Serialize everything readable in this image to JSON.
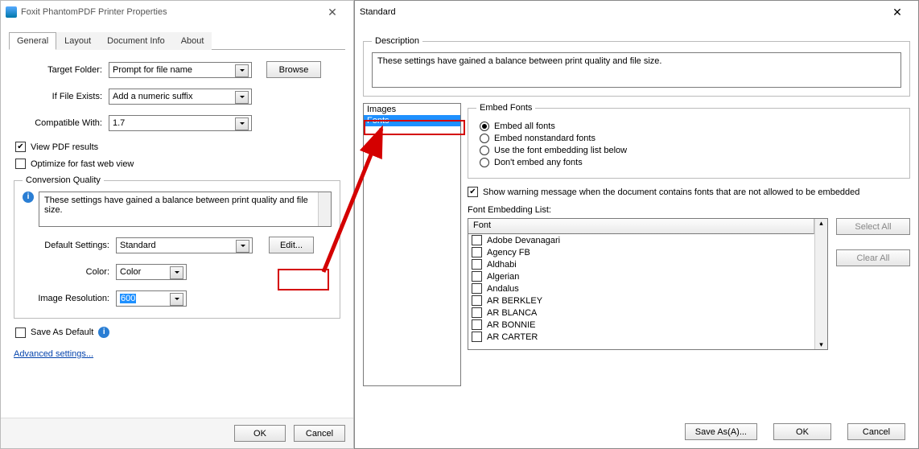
{
  "left": {
    "title": "Foxit PhantomPDF Printer Properties",
    "tabs": [
      "General",
      "Layout",
      "Document Info",
      "About"
    ],
    "activeTab": 0,
    "targetFolder": {
      "label": "Target Folder:",
      "value": "Prompt for file name",
      "browse": "Browse"
    },
    "ifExists": {
      "label": "If File Exists:",
      "value": "Add a numeric suffix"
    },
    "compatible": {
      "label": "Compatible With:",
      "value": "1.7"
    },
    "viewPdf": {
      "label": "View PDF results",
      "checked": true
    },
    "optimize": {
      "label": "Optimize for fast web view",
      "checked": false
    },
    "quality": {
      "legend": "Conversion Quality",
      "desc": "These settings have gained a balance between print quality and file size.",
      "defaultSettings": {
        "label": "Default Settings:",
        "value": "Standard",
        "edit": "Edit..."
      },
      "color": {
        "label": "Color:",
        "value": "Color"
      },
      "resolution": {
        "label": "Image Resolution:",
        "value": "600"
      }
    },
    "saveDefault": {
      "label": "Save As Default",
      "checked": false
    },
    "advanced": "Advanced settings...",
    "ok": "OK",
    "cancel": "Cancel"
  },
  "right": {
    "title": "Standard",
    "desc": {
      "legend": "Description",
      "text": "These settings have gained a balance between print quality and file size."
    },
    "categories": [
      "Images",
      "Fonts"
    ],
    "selectedCategory": 1,
    "embed": {
      "legend": "Embed Fonts",
      "options": [
        "Embed all fonts",
        "Embed nonstandard fonts",
        "Use the font embedding list below",
        "Don't embed any fonts"
      ],
      "selected": 0
    },
    "warning": {
      "label": "Show warning message when the document contains fonts that are not allowed to be embedded",
      "checked": true
    },
    "fontList": {
      "label": "Font Embedding List:",
      "header": "Font",
      "fonts": [
        "Adobe Devanagari",
        "Agency FB",
        "Aldhabi",
        "Algerian",
        "Andalus",
        "AR BERKLEY",
        "AR BLANCA",
        "AR BONNIE",
        "AR CARTER"
      ]
    },
    "selectAll": "Select All",
    "clearAll": "Clear All",
    "saveAs": "Save As(A)...",
    "ok": "OK",
    "cancel": "Cancel"
  }
}
